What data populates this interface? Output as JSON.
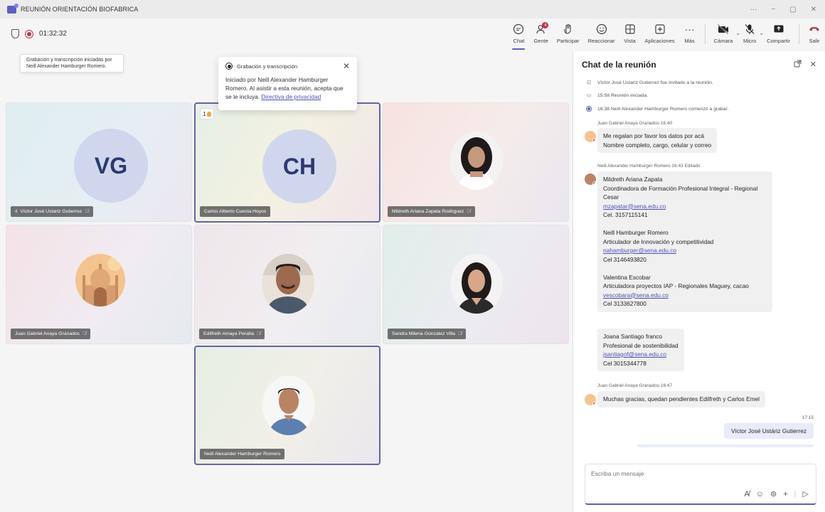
{
  "window": {
    "title": "REUNIÓN ORIENTACIÓN BIOFABRICA",
    "controls": {
      "more": "···",
      "minimize": "−",
      "restore": "▢",
      "close": "✕"
    }
  },
  "toolbar": {
    "timer": "01:32:32",
    "items": [
      {
        "id": "chat",
        "label": "Chat",
        "icon": "chat-icon"
      },
      {
        "id": "people",
        "label": "Gente",
        "icon": "people-icon",
        "badge": "4"
      },
      {
        "id": "raise",
        "label": "Participar",
        "icon": "raise-hand-icon"
      },
      {
        "id": "react",
        "label": "Reaccionar",
        "icon": "smiley-icon"
      },
      {
        "id": "view",
        "label": "Vista",
        "icon": "grid-icon"
      },
      {
        "id": "apps",
        "label": "Aplicaciones",
        "icon": "apps-icon"
      },
      {
        "id": "more",
        "label": "Más",
        "icon": "more-icon"
      },
      {
        "id": "camera",
        "label": "Cámara",
        "icon": "camera-off-icon"
      },
      {
        "id": "mic",
        "label": "Micro",
        "icon": "mic-off-icon"
      },
      {
        "id": "share",
        "label": "Compartir",
        "icon": "share-icon"
      },
      {
        "id": "leave",
        "label": "Salir",
        "icon": "phone-hangup-icon"
      }
    ]
  },
  "tooltip": {
    "line1": "Grabación y transcripción iniciadas por",
    "line2": "Neill Alexander Hamburger Romero."
  },
  "recording_popup": {
    "title": "Grabación y transcripción",
    "body": "Iniciado por Neill Alexander Hamburger Romero. Al asistir a esta reunión, acepta que se le incluya.",
    "link": "Directiva de privacidad"
  },
  "participants": [
    {
      "name": "Víctor José Ustariz Gutierrez",
      "initials": "VG",
      "muted": true
    },
    {
      "name": "Carlos Alberto Cuesta Hoyos",
      "initials": "CH",
      "muted": false,
      "hand_raised": "1"
    },
    {
      "name": "Mildreth Ariana Zapata Rodriguez",
      "muted": true
    },
    {
      "name": "Juan Gabriel Anaya Granados",
      "muted": true
    },
    {
      "name": "Edilfreth Amaya Peralta",
      "muted": true
    },
    {
      "name": "Sandra Milena Gonzalez Villa",
      "muted": true
    },
    {
      "name": "Neill Alexander Hamburger Romero",
      "muted": false
    }
  ],
  "chat": {
    "title": "Chat de la reunión",
    "system": [
      {
        "text": "Víctor José Ustariz Gutierrez fue invitado a la reunión."
      },
      {
        "text": "15:58   Reunión iniciada."
      },
      {
        "text": "16:38   Neill Alexander Hamburger Romero comenzó a grabar."
      }
    ],
    "messages": [
      {
        "meta": "Juan Gabriel Anaya Granados  16:40",
        "lines": [
          "Me regalan por favor los datos por acá",
          "Nombre completo, cargo, celular y correo"
        ]
      },
      {
        "meta": "Neill Alexander Hamburger Romero  16:43  Editado",
        "block1": [
          "Mildreth Ariana Zapata",
          "Coordinadora de Formación Profesional Integral - Regional",
          "Cesar",
          "mzapatar@sena.edu.co",
          "Cel. 3157115141",
          "",
          "Neill Hamburger Romero",
          "Articulador de Innovación y competitividad",
          "nahamburger@sena.edu.co",
          "Cel 3146493820",
          "",
          "Valentina Escobar",
          "Articuladora proyectos IAP - Regionales Maguey, cacao",
          "vescobara@sena.edu.co",
          "Cel 3133627800"
        ],
        "block2": [
          "Joana Santiago franco",
          "Profesional de sostenibilidad",
          "jsantiagof@sena.edu.co",
          "Cel 3015344778"
        ]
      },
      {
        "meta": "Juan Gabriel Anaya Granados  16:47",
        "lines": [
          "Muchas gracias, quedan pendientes Edilfreth y Carlos Emel"
        ]
      }
    ],
    "own": {
      "time": "17:15",
      "text": "Víctor José Ustáriz Gutierrez"
    },
    "composer_placeholder": "Escriba un mensaje"
  }
}
